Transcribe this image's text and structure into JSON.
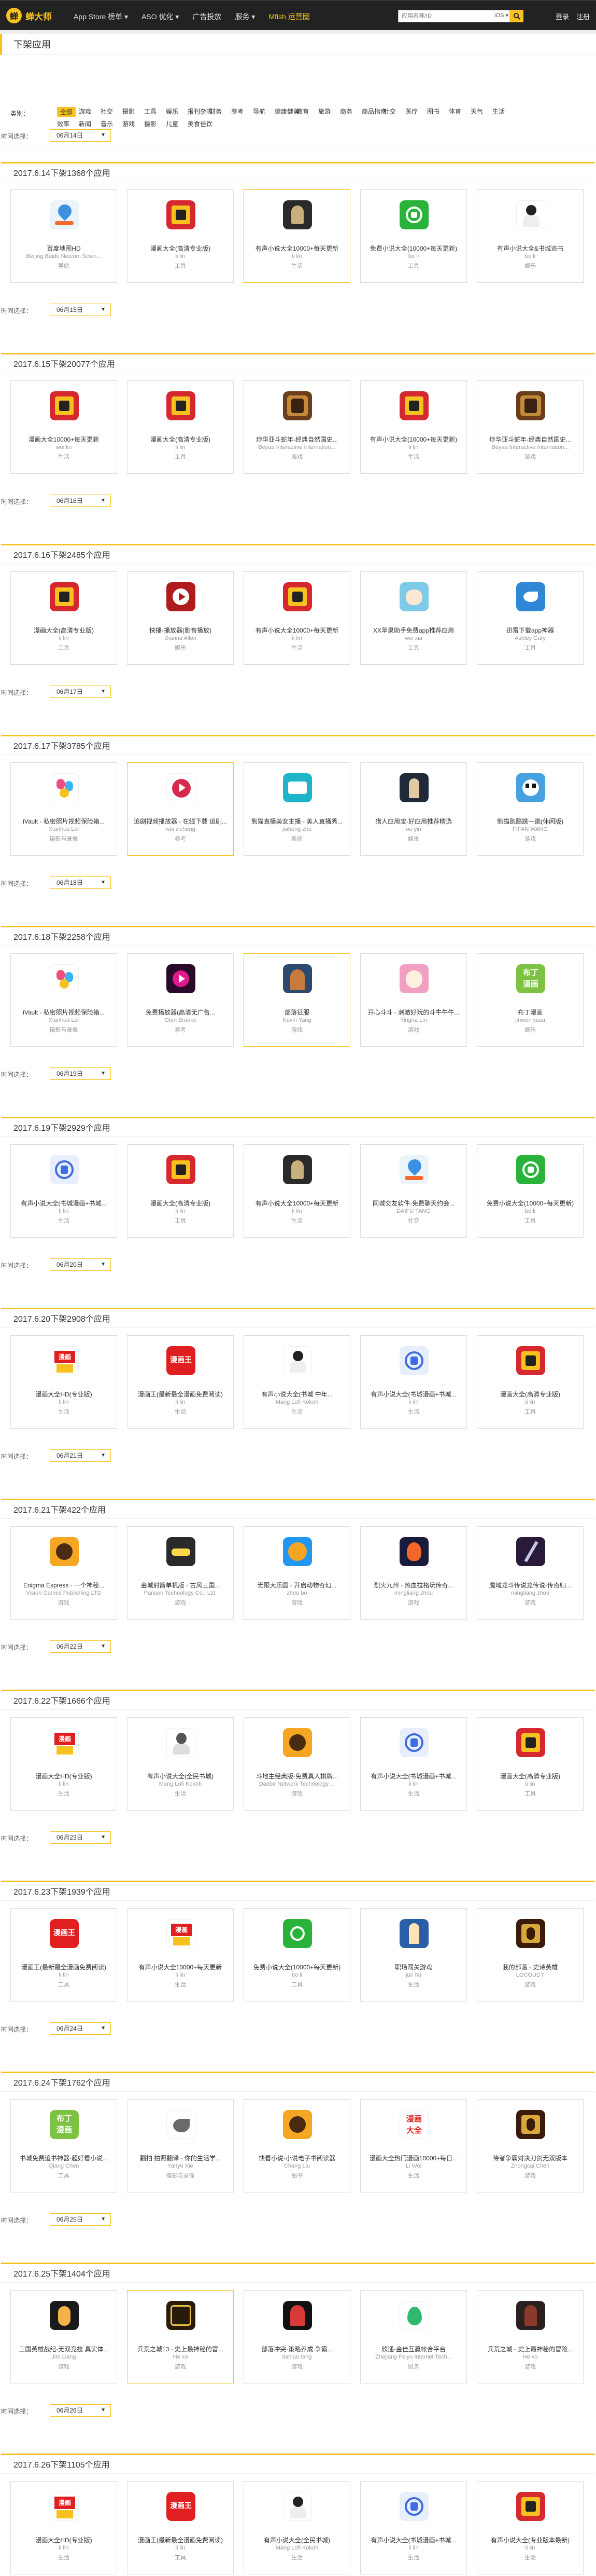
{
  "nav": {
    "logo": "蝉大师",
    "logo_glyph": "蝉",
    "items": [
      "App Store 榜单 ▾",
      "ASO 优化 ▾",
      "广告投放",
      "服务 ▾",
      "Mfish 运营圈"
    ],
    "search_placeholder": "应用名称/ID",
    "search_select": "iOS ▾",
    "login": "登录",
    "register": "注册"
  },
  "page_title": "下架应用",
  "filter": {
    "label": "类别：",
    "categories": [
      "全部",
      "游戏",
      "社交",
      "摄影",
      "工具",
      "娱乐",
      "报刊杂志",
      "财务",
      "参考",
      "导航",
      "健康健美",
      "教育",
      "旅游",
      "商务",
      "商品指南",
      "社交",
      "医疗",
      "图书",
      "体育",
      "天气",
      "生活",
      "效率",
      "新闻",
      "音乐",
      "游戏",
      "摄影",
      "儿童",
      "美食佳饮"
    ]
  },
  "date_label": "时间选择：",
  "sections": [
    {
      "title": "2017.6.14下架1368个应用",
      "date": "06月14日",
      "prev_date": "06月14日",
      "cards": [
        {
          "name": "百度地图HD",
          "dev": "Beijing Baidu Netcom Scien...",
          "cat": "导航",
          "icon": "map"
        },
        {
          "name": "漫画大全(高清专业版)",
          "dev": "li lin",
          "cat": "工具",
          "icon": "manga"
        },
        {
          "name": "有声小说大全10000+每天更新",
          "dev": "li lin",
          "cat": "生活",
          "icon": "dark",
          "hl": true
        },
        {
          "name": "免费小说大全(10000+每天更新)",
          "dev": "bo li",
          "cat": "工具",
          "icon": "book"
        },
        {
          "name": "有声小说大全&书城追书",
          "dev": "bo li",
          "cat": "娱乐",
          "icon": "person"
        }
      ]
    },
    {
      "title": "2017.6.15下架20077个应用",
      "date": "06月15日",
      "cards": [
        {
          "name": "漫画大全10000+每天更新",
          "dev": "wei lin",
          "cat": "生活",
          "icon": "manga"
        },
        {
          "name": "漫画大全(高清专业版)",
          "dev": "li lin",
          "cat": "工具",
          "icon": "manga"
        },
        {
          "name": "炒华亚斗蛇年-经典自然国史...",
          "dev": "Beyaa Interactive Internation...",
          "cat": "游戏",
          "icon": "game"
        },
        {
          "name": "有声小说大全(10000+每天更新)",
          "dev": "li lin",
          "cat": "生活",
          "icon": "manga"
        },
        {
          "name": "炒华亚斗蛇年-经典自然国史...",
          "dev": "Beyaa Interactive Internation...",
          "cat": "游戏",
          "icon": "game"
        }
      ]
    },
    {
      "title": "2017.6.16下架2485个应用",
      "date": "06月16日",
      "cards": [
        {
          "name": "漫画大全(高清专业版)",
          "dev": "li lin",
          "cat": "工具",
          "icon": "manga"
        },
        {
          "name": "快播-播放器(影音播放)",
          "dev": "Dianna Allen",
          "cat": "娱乐",
          "icon": "video"
        },
        {
          "name": "有声小说大全10000+每天更新",
          "dev": "li lin",
          "cat": "生活",
          "icon": "manga"
        },
        {
          "name": "XX苹果助手免费app推荐应用",
          "dev": "wei xia",
          "cat": "工具",
          "icon": "cat"
        },
        {
          "name": "迅雷下载app神器",
          "dev": "Ashley Gary",
          "cat": "工具",
          "icon": "bird"
        }
      ]
    },
    {
      "title": "2017.6.17下架3785个应用",
      "date": "06月17日",
      "cards": [
        {
          "name": "iVault - 私密照片视频保险箱...",
          "dev": "Xianhua Lai",
          "cat": "摄影与录像",
          "icon": "ivault"
        },
        {
          "name": "追剧视频播放器 - 在线下载 追剧...",
          "dev": "wei zicheng",
          "cat": "参考",
          "icon": "pinkplay",
          "hl": true
        },
        {
          "name": "熊猫直播美女主播 - 美人直播秀...",
          "dev": "jiahong zhu",
          "cat": "新闻",
          "icon": "teal"
        },
        {
          "name": "猎人应用宝-好应用推荐精选",
          "dev": "ou yin",
          "cat": "娱乐",
          "icon": "darkfig"
        },
        {
          "name": "熊猫跑酷跳一跳(休闲版)",
          "dev": "FIFAN WANG",
          "cat": "游戏",
          "icon": "panda"
        }
      ]
    },
    {
      "title": "2017.6.18下架2258个应用",
      "date": "06月18日",
      "cards": [
        {
          "name": "iVault - 私密照片视频保险箱...",
          "dev": "Xianhua Lai",
          "cat": "摄影与录像",
          "icon": "ivault"
        },
        {
          "name": "免费播放器(高清无广告...",
          "dev": "Glen Brooks",
          "cat": "参考",
          "icon": "magenta"
        },
        {
          "name": "部落征服",
          "dev": "Kevin Yang",
          "cat": "游戏",
          "icon": "warrior",
          "hl": true
        },
        {
          "name": "开心斗斗 - 刺激好玩的斗牛牛牛...",
          "dev": "Yingna Lin",
          "cat": "游戏",
          "icon": "anime"
        },
        {
          "name": "布丁漫画",
          "dev": "jinwen yasu",
          "cat": "娱乐",
          "icon": "green"
        }
      ]
    },
    {
      "title": "2017.6.19下架2929个应用",
      "date": "06月19日",
      "cards": [
        {
          "name": "有声小说大全(书城漫画+书城...",
          "dev": "li lin",
          "cat": "生活",
          "icon": "blue"
        },
        {
          "name": "漫画大全(高清专业版)",
          "dev": "li lin",
          "cat": "工具",
          "icon": "manga"
        },
        {
          "name": "有声小说大全10000+每天更新",
          "dev": "li lin",
          "cat": "生活",
          "icon": "dark"
        },
        {
          "name": "同城交友软件-免费聊天约会...",
          "dev": "DAIFU TANG",
          "cat": "社交",
          "icon": "map"
        },
        {
          "name": "免费小说大全(10000+每天更新)",
          "dev": "bo li",
          "cat": "工具",
          "icon": "book"
        }
      ]
    },
    {
      "title": "2017.6.20下架2908个应用",
      "date": "06月20日",
      "cards": [
        {
          "name": "漫画大全HD(专业版)",
          "dev": "li lin",
          "cat": "生活",
          "icon": "mangacat"
        },
        {
          "name": "漫画王(最新最全漫画免费阅读)",
          "dev": "li lin",
          "cat": "生活",
          "icon": "red"
        },
        {
          "name": "有声小说大全(书城 中年...",
          "dev": "Mang Lofi Kokoh",
          "cat": "生活",
          "icon": "person"
        },
        {
          "name": "有声小说大全(书城漫画+书城...",
          "dev": "li lin",
          "cat": "生活",
          "icon": "blue"
        },
        {
          "name": "漫画大全(高清专业版)",
          "dev": "li lin",
          "cat": "工具",
          "icon": "manga"
        }
      ]
    },
    {
      "title": "2017.6.21下架422个应用",
      "date": "06月21日",
      "cards": [
        {
          "name": "Enigma Express - 一个神秘...",
          "dev": "Vision Games Publishing LTD",
          "cat": "游戏",
          "icon": "orange"
        },
        {
          "name": "金城射箭单机版 - 古风三国...",
          "dev": "Pansen Technology Co., Ltd.",
          "cat": "游戏",
          "icon": "lambo"
        },
        {
          "name": "无限大乐园 - 开启动物奇幻...",
          "dev": "zhou bo",
          "cat": "游戏",
          "icon": "chat"
        },
        {
          "name": "烈火九州 - 热血拉格玩传奇...",
          "dev": "mingliang zhou",
          "cat": "游戏",
          "icon": "fire"
        },
        {
          "name": "魔域龙斗传说龙传说-传奇归...",
          "dev": "mingliang zhou",
          "cat": "游戏",
          "icon": "knife"
        }
      ]
    },
    {
      "title": "2017.6.22下架1666个应用",
      "date": "06月22日",
      "cards": [
        {
          "name": "漫画大全HD(专业版)",
          "dev": "li lin",
          "cat": "生活",
          "icon": "mangacat"
        },
        {
          "name": "有声小说大全(全民书城)",
          "dev": "Mang Lofi Kokoh",
          "cat": "生活",
          "icon": "bigwhite"
        },
        {
          "name": "斗地主经典版-免费真人棋牌...",
          "dev": "Daebe Network Technology ...",
          "cat": "游戏",
          "icon": "orange"
        },
        {
          "name": "有声小说大全(书城漫画+书城...",
          "dev": "li lin",
          "cat": "生活",
          "icon": "blue"
        },
        {
          "name": "漫画大全(高清专业版)",
          "dev": "li lin",
          "cat": "工具",
          "icon": "manga"
        }
      ]
    },
    {
      "title": "2017.6.23下架1939个应用",
      "date": "06月23日",
      "cards": [
        {
          "name": "漫画王(最新最全漫画免费阅读)",
          "dev": "li lin",
          "cat": "工具",
          "icon": "red"
        },
        {
          "name": "有声小说大全10000+每天更新",
          "dev": "li lin",
          "cat": "生活",
          "icon": "mangacat"
        },
        {
          "name": "免费小说大全(10000+每天更新)",
          "dev": "bo li",
          "cat": "工具",
          "icon": "bigcheck"
        },
        {
          "name": "职场闯关游戏",
          "dev": "jun hu",
          "cat": "生活",
          "icon": "bluefig"
        },
        {
          "name": "我的部落 - 史诗英雄",
          "dev": "LOCOUDY",
          "cat": "游戏",
          "icon": "kingdom"
        }
      ]
    },
    {
      "title": "2017.6.24下架1762个应用",
      "date": "06月24日",
      "cards": [
        {
          "name": "书城免费追书神器-超好看小说...",
          "dev": "Qiang Chen",
          "cat": "工具",
          "icon": "green"
        },
        {
          "name": "翻拍 拍照翻译 - 你的生活学...",
          "dev": "Yanyu Xie",
          "cat": "摄影与录像",
          "icon": "whitebird"
        },
        {
          "name": "快看小说-小说电子书阅读器",
          "dev": "Chang Liu",
          "cat": "图书",
          "icon": "orange"
        },
        {
          "name": "漫画大全热门漫画10000+每日...",
          "dev": "Li Wei",
          "cat": "生活",
          "icon": "redlight"
        },
        {
          "name": "侍者争霸对决刀剑无双版本",
          "dev": "Zhongcai Chen",
          "cat": "游戏",
          "icon": "kingdom"
        }
      ]
    },
    {
      "title": "2017.6.25下架1404个应用",
      "date": "06月25日",
      "cards": [
        {
          "name": "三国英雄战纪-无双竞技 真实体...",
          "dev": "Jim Liang",
          "cat": "游戏",
          "icon": "jumpman"
        },
        {
          "name": "兵荒之城13 - 史上最神秘的冒...",
          "dev": "He xo",
          "cat": "游戏",
          "icon": "gamegold",
          "hl": true
        },
        {
          "name": "部落冲突-策略养成 争霸...",
          "dev": "tianluo tang",
          "cat": "游戏",
          "icon": "blackface"
        },
        {
          "name": "欣通-金佳互赢帐合平台",
          "dev": "Zhejiang Feiyu Internet Tech...",
          "cat": "财务",
          "icon": "drop"
        },
        {
          "name": "兵荒之城 - 史上最神秘的冒险...",
          "dev": "He xo",
          "cat": "游戏",
          "icon": "darkhero"
        }
      ]
    },
    {
      "title": "2017.6.26下架1105个应用",
      "date": "06月26日",
      "cards": [
        {
          "name": "漫画大全HD(专业版)",
          "dev": "li lin",
          "cat": "生活",
          "icon": "mangacat"
        },
        {
          "name": "漫画王(最新最全漫画免费阅读)",
          "dev": "li lin",
          "cat": "工具",
          "icon": "red"
        },
        {
          "name": "有声小说大全(全民书城)",
          "dev": "Mang Lofi Kokoh",
          "cat": "生活",
          "icon": "person"
        },
        {
          "name": "有声小说大全(书城漫画+书城...",
          "dev": "li lin",
          "cat": "生活",
          "icon": "blue"
        },
        {
          "name": "有声小说大全(专业版本最新)",
          "dev": "li lin",
          "cat": "生活",
          "icon": "manga"
        }
      ]
    }
  ],
  "icon_text": {
    "green": "布丁\n漫画",
    "red": "漫画王",
    "redlight": "漫画\n大全",
    "mangacat": "漫画"
  }
}
